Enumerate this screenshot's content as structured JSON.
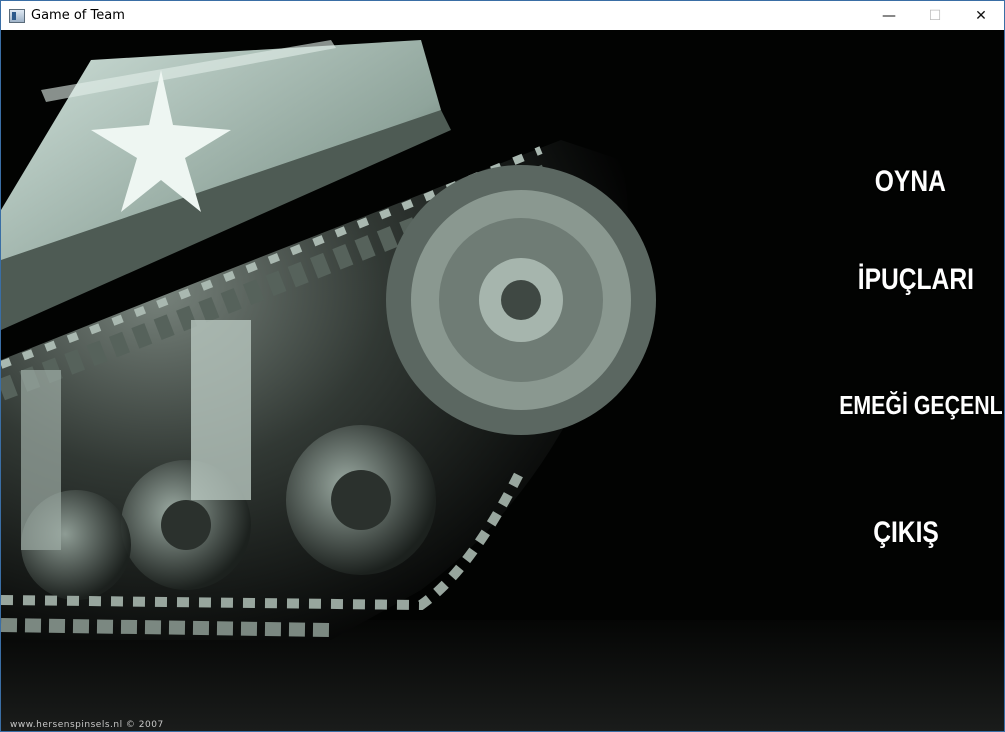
{
  "window": {
    "title": "Game of Team",
    "minimize_glyph": "—",
    "maximize_glyph": "☐",
    "close_glyph": "✕",
    "accent": "#3a6ea5"
  },
  "menu": {
    "play_label": "OYNA",
    "hints_label": "İPUÇLARI",
    "credits_label": "EMEĞİ GEÇENLER",
    "exit_label": "ÇIKIŞ",
    "text_color": "#ffffff"
  },
  "background": {
    "icon": "tank-track-photo",
    "watermark": "www.hersenspinsels.nl © 2007"
  }
}
